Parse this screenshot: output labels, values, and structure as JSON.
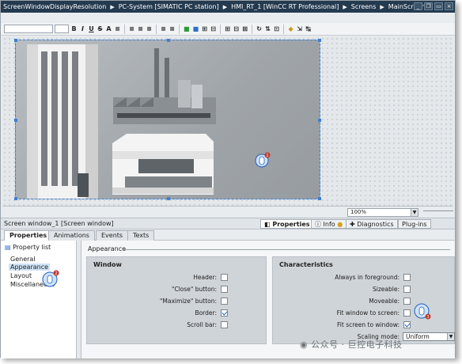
{
  "titlebar": {
    "crumbs": [
      "ScreenWindowDisplayResolution",
      "PC-System [SIMATIC PC station]",
      "HMI_RT_1 [WinCC RT Professional]",
      "Screens",
      "MainScreen"
    ]
  },
  "toolbar": {
    "buttons": [
      "B",
      "I",
      "U",
      "S",
      "A",
      "≡",
      "≡",
      "≡",
      "≡",
      "≡",
      "≡"
    ]
  },
  "canvas": {
    "zoom": "100%",
    "marker1": "1"
  },
  "inspector": {
    "title": "Screen window_1 [Screen window]",
    "tabs": {
      "properties": "Properties",
      "info": "Info",
      "diagnostics": "Diagnostics",
      "plugins": "Plug-ins"
    }
  },
  "tabs": [
    "Properties",
    "Animations",
    "Events",
    "Texts"
  ],
  "nav": {
    "header": "Property list",
    "items": [
      "General",
      "Appearance",
      "Layout",
      "Miscellaneous"
    ],
    "marker2": "2"
  },
  "content": {
    "section": "Appearance",
    "window_group": {
      "title": "Window",
      "rows": [
        {
          "label": "Header:",
          "checked": false
        },
        {
          "label": "\"Close\" button:",
          "checked": false
        },
        {
          "label": "\"Maximize\" button:",
          "checked": false
        },
        {
          "label": "Border:",
          "checked": true
        },
        {
          "label": "Scroll bar:",
          "checked": false
        }
      ]
    },
    "characteristics_group": {
      "title": "Characteristics",
      "rows": [
        {
          "label": "Always in foreground:",
          "checked": false
        },
        {
          "label": "Sizeable:",
          "checked": false
        },
        {
          "label": "Moveable:",
          "checked": false
        },
        {
          "label": "Fit window to screen:",
          "checked": false
        },
        {
          "label": "Fit screen to window:",
          "checked": true
        }
      ],
      "scaling_label": "Scaling mode:",
      "scaling_value": "Uniform",
      "marker3": "3"
    }
  },
  "watermark": "公众号 · 巨控电子科技",
  "colors": {
    "titlebar": "#243a4f",
    "selection": "#3f7fd1",
    "marker": "#1d5fbf",
    "marker_badge": "#c0392b"
  }
}
